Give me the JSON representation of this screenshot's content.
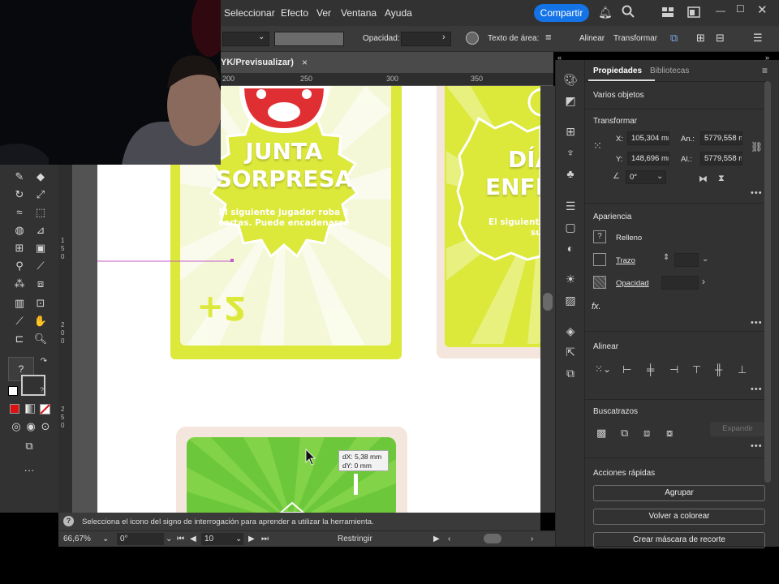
{
  "menu": {
    "items": [
      "Seleccionar",
      "Efecto",
      "Ver",
      "Ventana",
      "Ayuda"
    ],
    "share_label": "Compartir"
  },
  "controlbar": {
    "opacity_label": "Opacidad:",
    "text_area_label": "Texto de área:",
    "align_label": "Alinear",
    "transform_label": "Transformar"
  },
  "document": {
    "tab_title": "YK/Previsualizar)",
    "close_glyph": "×"
  },
  "ruler": {
    "top_ticks": [
      "200",
      "250",
      "300",
      "350"
    ],
    "left_ticks": [
      [
        "1",
        "5",
        "0"
      ],
      [
        "2",
        "0",
        "0"
      ],
      [
        "2",
        "5",
        "0"
      ]
    ]
  },
  "cards": {
    "card1_title_line1": "JUNTA",
    "card1_title_line2": "SORPRESA",
    "card1_desc": "El siguiente jugador roba 2 cartas. Puede encadenarse",
    "card1_value": "+2",
    "card2_title_line1": "DÍA",
    "card2_title_line2": "ENFE",
    "card2_desc_line1": "El siguient",
    "card2_desc_line2": "su"
  },
  "tooltip": {
    "dx": "dX: 5,38 mm",
    "dy": "dY: 0 mm"
  },
  "properties": {
    "tab_active": "Propiedades",
    "tab_inactive": "Bibliotecas",
    "selection": "Varios objetos",
    "transform_heading": "Transformar",
    "x_label": "X:",
    "x_value": "105,304 mr",
    "y_label": "Y:",
    "y_value": "148,696 mr",
    "w_label": "An.:",
    "w_value": "5779,558 m",
    "h_label": "Al.:",
    "h_value": "5779,558 m",
    "angle_value": "0°",
    "appearance_heading": "Apariencia",
    "fill_label": "Relleno",
    "stroke_label": "Trazo",
    "opacity_label": "Opacidad",
    "fx_label": "fx.",
    "align_heading": "Alinear",
    "pathfinder_heading": "Buscatrazos",
    "expand_label": "Expandir",
    "quick_actions_heading": "Acciones rápidas",
    "group_button": "Agrupar",
    "recolor_button": "Volver a colorear",
    "clip_mask_button": "Crear máscara de recorte"
  },
  "status": {
    "hint": "Selecciona el icono del signo de interrogación para aprender a utilizar la herramienta.",
    "zoom": "66,67%",
    "rotation": "0°",
    "artboard_number": "10",
    "mode": "Restringir"
  },
  "colors": {
    "accent": "#1473e6",
    "card_yellow": "#dce83a",
    "card_green": "#6cc83a",
    "card_beige": "#f4e6dc",
    "ui_dark": "#323232"
  }
}
